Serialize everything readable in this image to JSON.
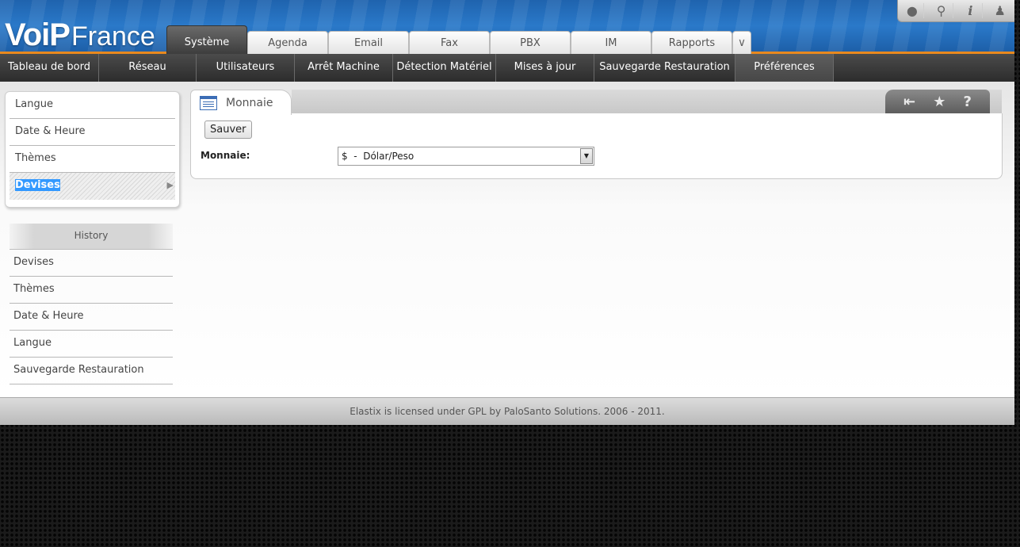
{
  "app": {
    "logo": {
      "part1": "Vo",
      "part2": "iP",
      "part3": "France"
    },
    "tabs": [
      {
        "label": "Système",
        "active": true
      },
      {
        "label": "Agenda"
      },
      {
        "label": "Email"
      },
      {
        "label": "Fax"
      },
      {
        "label": "PBX"
      },
      {
        "label": "IM"
      },
      {
        "label": "Rapports"
      }
    ],
    "top_icons": [
      "drop-icon",
      "search-icon",
      "info-icon",
      "user-icon"
    ]
  },
  "subnav": [
    {
      "label": "Tableau de bord"
    },
    {
      "label": "Réseau"
    },
    {
      "label": "Utilisateurs"
    },
    {
      "label": "Arrêt Machine"
    },
    {
      "label": "Détection Matériel"
    },
    {
      "label": "Mises à jour"
    },
    {
      "label": "Sauvegarde Restauration"
    },
    {
      "label": "Préférences",
      "active": true
    }
  ],
  "sidebar": {
    "items": [
      {
        "label": "Langue"
      },
      {
        "label": "Date & Heure"
      },
      {
        "label": "Thèmes"
      },
      {
        "label": "Devises",
        "selected": true
      }
    ],
    "history_title": "History",
    "history": [
      {
        "label": "Devises"
      },
      {
        "label": "Thèmes"
      },
      {
        "label": "Date & Heure"
      },
      {
        "label": "Langue"
      },
      {
        "label": "Sauvegarde Restauration"
      }
    ]
  },
  "panel": {
    "title": "Monnaie",
    "save_label": "Sauver",
    "field_label": "Monnaie:",
    "currency_value": "$  -  Dólar/Peso"
  },
  "footer": {
    "text": "Elastix is licensed under GPL by PaloSanto Solutions. 2006 - 2011."
  },
  "colors": {
    "accent": "#e8891f",
    "header_blue": "#2a79c9",
    "selection": "#3399ff"
  }
}
